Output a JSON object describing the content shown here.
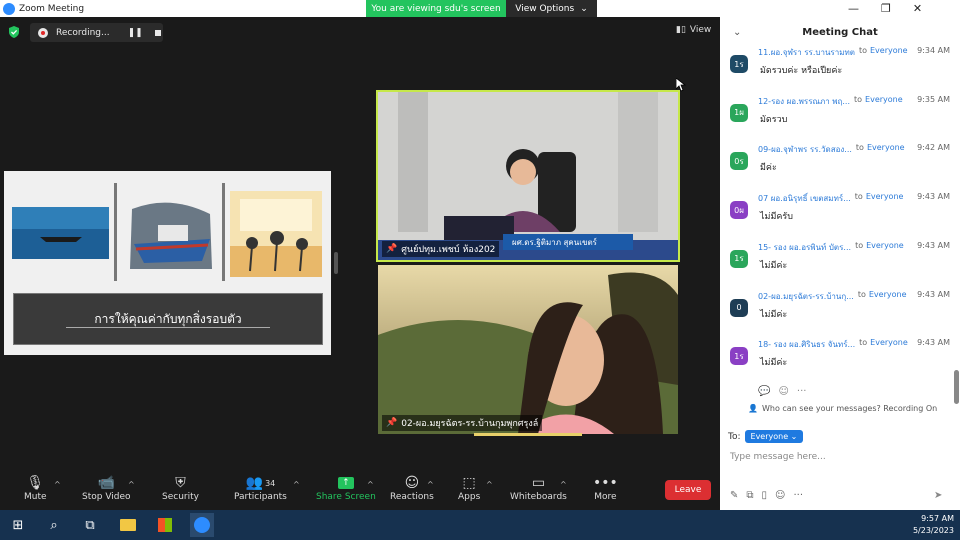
{
  "window": {
    "title": "Zoom Meeting"
  },
  "share_banner": {
    "text": "You are viewing sdu's screen",
    "options_label": "View Options"
  },
  "recording": {
    "label": "Recording..."
  },
  "view_button": {
    "label": "View"
  },
  "slide": {
    "title": "การให้คุณค่ากับทุกสิ่งรอบตัว"
  },
  "videos": [
    {
      "name": "ศูนย์ปทุม.เพชบ์ ห้อง202",
      "caption": "ผศ.ดร.ฐิติมาภ สุคนเขตร์"
    },
    {
      "name": "02-ผอ.มยุรฉัตร-รร.บ้านกุมพุกศรุงล์"
    }
  ],
  "toolbar": {
    "mute": "Mute",
    "stop_video": "Stop Video",
    "security": "Security",
    "participants": "Participants",
    "participants_count": "34",
    "share_screen": "Share Screen",
    "reactions": "Reactions",
    "apps": "Apps",
    "whiteboards": "Whiteboards",
    "more": "More",
    "leave": "Leave"
  },
  "chat": {
    "title": "Meeting Chat",
    "to_word": "to",
    "messages": [
      {
        "sender": "11.ผอ.จุฬรา รร.บานรามทต",
        "recipient": "Everyone",
        "time": "9:34 AM",
        "avatar": "1ร",
        "avatar_color": "#1e4a66",
        "text": "มัดรวบค่ะ หรือเปียค่ะ"
      },
      {
        "sender": "12-รอง ผอ.พรรณภา พฤ...",
        "recipient": "Everyone",
        "time": "9:35 AM",
        "avatar": "1ผ",
        "avatar_color": "#2aa65b",
        "text": "มัดรวบ"
      },
      {
        "sender": "09-ผอ.จุฬาพร  รร.วัดสอง...",
        "recipient": "Everyone",
        "time": "9:42 AM",
        "avatar": "0ร",
        "avatar_color": "#2aa65b",
        "text": "มีค่ะ"
      },
      {
        "sender": "07 ผอ.อนิรุทธิ์  เขตสมทร์...",
        "recipient": "Everyone",
        "time": "9:43 AM",
        "avatar": "0ผ",
        "avatar_color": "#8a3fc4",
        "text": "ไม่มีครับ"
      },
      {
        "sender": "15- รอง ผอ.อรพินท์ บัตร...",
        "recipient": "Everyone",
        "time": "9:43 AM",
        "avatar": "1ร",
        "avatar_color": "#2aa65b",
        "text": "ไม่มีค่ะ"
      },
      {
        "sender": "02-ผอ.มยุรฉัตร-รร.บ้านกุ...",
        "recipient": "Everyone",
        "time": "9:43 AM",
        "avatar": "0",
        "avatar_color": "#1e3d55",
        "text": "ไม่มีค่ะ"
      },
      {
        "sender": "18- รอง ผอ.ศิรินธร จันทร์...",
        "recipient": "Everyone",
        "time": "9:43 AM",
        "avatar": "1ร",
        "avatar_color": "#8a3fc4",
        "text": "ไม่มีค่ะ"
      }
    ],
    "who_can_see": "Who can see your messages? Recording On",
    "to_label": "To:",
    "to_value": "Everyone",
    "input_placeholder": "Type message here..."
  },
  "taskbar": {
    "time": "9:57 AM",
    "date": "5/23/2023"
  }
}
